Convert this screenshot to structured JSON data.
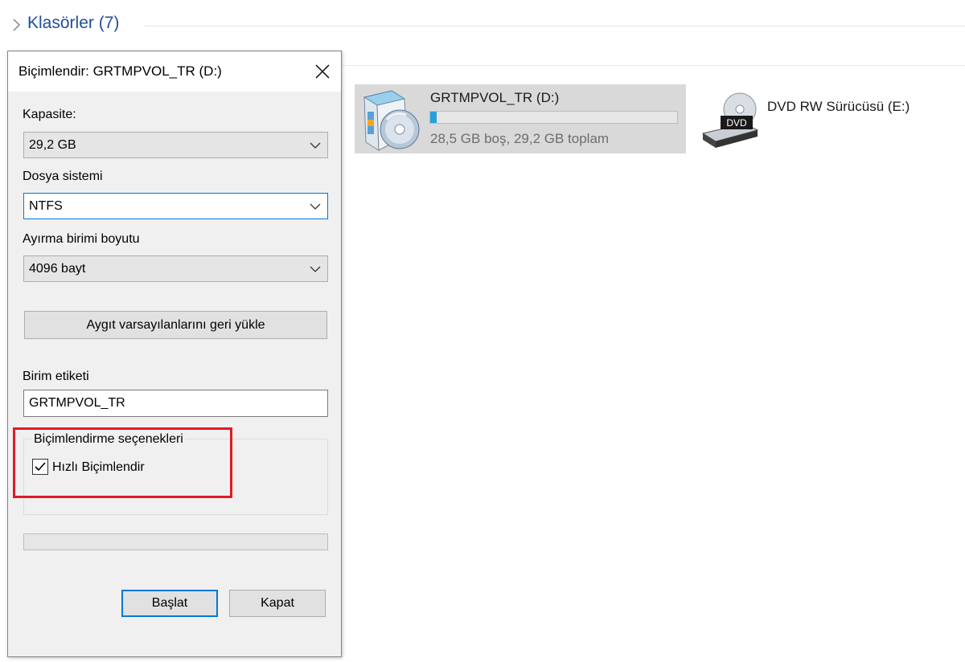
{
  "explorer": {
    "group_title": "Klasörler (7)",
    "drive_d": {
      "name": "GRTMPVOL_TR (D:)",
      "free_text": "28,5 GB boş, 29,2 GB toplam",
      "used_fraction": 0.025
    },
    "drive_e": {
      "name": "DVD RW Sürücüsü (E:)",
      "icon_badge": "DVD"
    }
  },
  "dialog": {
    "title": "Biçimlendir: GRTMPVOL_TR (D:)",
    "capacity_label": "Kapasite:",
    "capacity_value": "29,2 GB",
    "filesystem_label": "Dosya sistemi",
    "filesystem_value": "NTFS",
    "allocation_label": "Ayırma birimi boyutu",
    "allocation_value": "4096 bayt",
    "restore_defaults_label": "Aygıt varsayılanlarını geri yükle",
    "volume_label_label": "Birim etiketi",
    "volume_label_value": "GRTMPVOL_TR",
    "format_options_label": "Biçimlendirme seçenekleri",
    "quick_format_label": "Hızlı Biçimlendir",
    "quick_format_checked": true,
    "progress": 0,
    "start_label": "Başlat",
    "close_label": "Kapat"
  },
  "colors": {
    "accent": "#0078d7",
    "highlight_box": "#e01b24",
    "progress_fill": "#26a0da",
    "group_title": "#1e4e9c"
  },
  "icons": {
    "drive_d": "usb-drive-setup-icon",
    "drive_e": "dvd-drive-icon",
    "close": "close-icon",
    "dropdown": "chevron-down-icon",
    "group": "chevron-right-icon"
  }
}
